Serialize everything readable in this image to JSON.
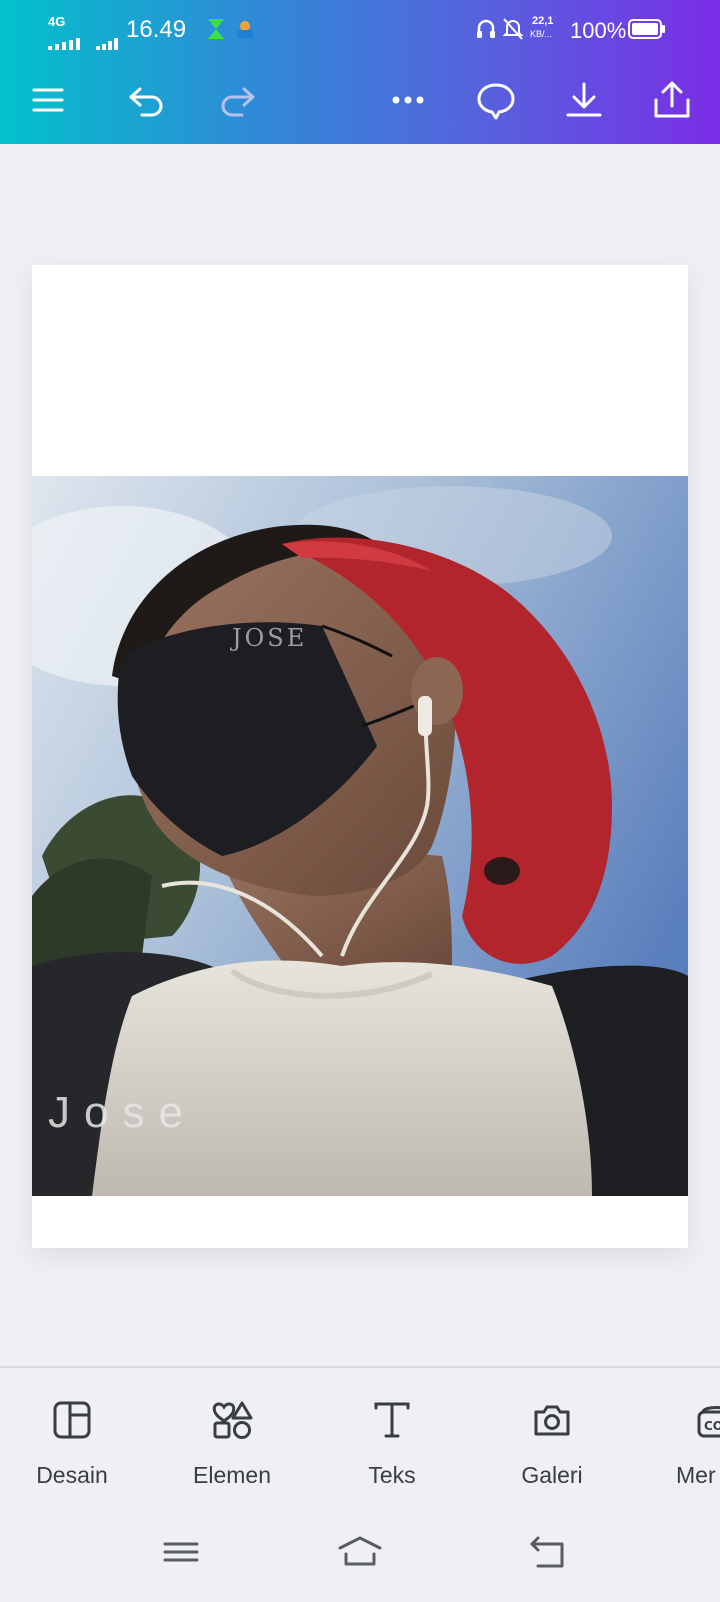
{
  "status_bar": {
    "network": "4G",
    "time": "16.49",
    "speed": "22,1",
    "speed_unit": "KB/...",
    "battery": "100%"
  },
  "toolbar": {
    "icons": [
      "menu-icon",
      "undo-icon",
      "redo-icon",
      "more-icon",
      "comment-icon",
      "download-icon",
      "share-icon"
    ]
  },
  "photo": {
    "overlay_small": "JOSE",
    "overlay_large": "Jose"
  },
  "bottom_tabs": [
    {
      "label": "Desain",
      "icon": "layout-icon"
    },
    {
      "label": "Elemen",
      "icon": "shapes-icon"
    },
    {
      "label": "Teks",
      "icon": "text-icon"
    },
    {
      "label": "Galeri",
      "icon": "camera-icon"
    },
    {
      "label": "Mer",
      "icon": "brand-icon"
    }
  ],
  "colors": {
    "gradient_start": "#03c1cc",
    "gradient_end": "#7a2ee6",
    "background": "#eff0f4"
  }
}
